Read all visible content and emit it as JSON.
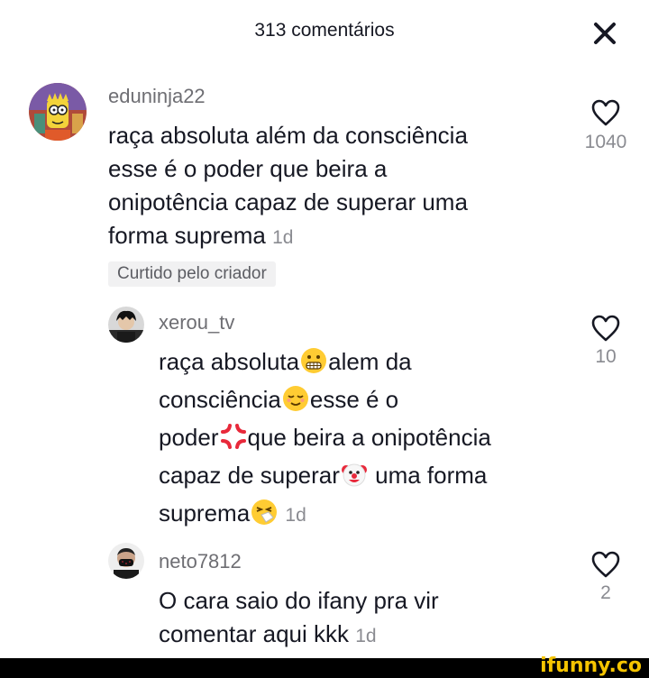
{
  "header": {
    "title": "313 comentários"
  },
  "comments": [
    {
      "username": "eduninja22",
      "text_lines": [
        "raça absoluta além da consciência",
        "esse é o poder que beira a",
        "onipotência capaz de superar uma",
        "forma suprema"
      ],
      "time": "1d",
      "like_count": "1040",
      "liked_by_creator": "Curtido pelo criador"
    }
  ],
  "replies": [
    {
      "username": "xerou_tv",
      "lines": [
        [
          "raça absoluta",
          "alem da"
        ],
        [
          "consciência",
          "esse é o"
        ],
        [
          "poder",
          "que beira a onipotência"
        ],
        [
          "capaz de superar",
          " uma forma"
        ],
        [
          "suprema"
        ]
      ],
      "emojis": [
        "grimacing-face",
        "relieved-face",
        "anger-symbol",
        "clown-face",
        "sneezing-face"
      ],
      "time": "1d",
      "like_count": "10"
    },
    {
      "username": "neto7812",
      "text_lines": [
        "O cara saio do ifany pra vir",
        "comentar aqui kkk"
      ],
      "time": "1d",
      "like_count": "2"
    }
  ],
  "watermark": "ifunny.co",
  "colors": {
    "text": "#161823",
    "secondary": "#8a8b91",
    "chip_bg": "#f1f1f2",
    "watermark": "#f5c400"
  }
}
